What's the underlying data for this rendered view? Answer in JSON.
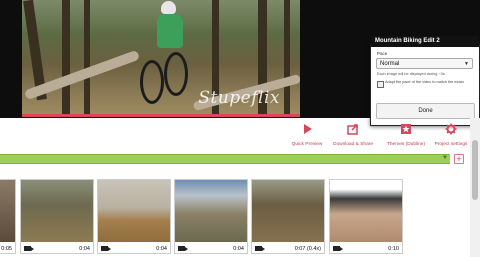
{
  "video": {
    "watermark": "Stupeflix"
  },
  "popup": {
    "title": "Mountain Biking Edit 2",
    "pace_label": "Pace",
    "pace_value": "Normal",
    "pace_info": "Each image will be displayed during ~3s.",
    "adapt_text": "Adapt the pace of the video to match the music",
    "done_label": "Done"
  },
  "toolbar": {
    "items": [
      {
        "label": "Quick Preview",
        "icon": "play-icon"
      },
      {
        "label": "Download & Share",
        "icon": "share-icon"
      },
      {
        "label": "Themes (Dubline)",
        "icon": "themes-icon"
      },
      {
        "label": "Project settings",
        "icon": "gear-icon"
      }
    ]
  },
  "colors": {
    "accent": "#c23a4f",
    "timeline_green": "#9dcd5a",
    "progress_red": "#e0445a"
  },
  "thumbnails": [
    {
      "duration": "0:05",
      "icon": "video-camera-icon"
    },
    {
      "duration": "0:04",
      "icon": "video-camera-icon"
    },
    {
      "duration": "0:04",
      "icon": "video-camera-icon"
    },
    {
      "duration": "0:04",
      "icon": "video-camera-icon"
    },
    {
      "duration": "0:07 (0.4x)",
      "icon": "video-camera-icon"
    },
    {
      "duration": "0:10",
      "icon": "video-camera-icon"
    }
  ]
}
